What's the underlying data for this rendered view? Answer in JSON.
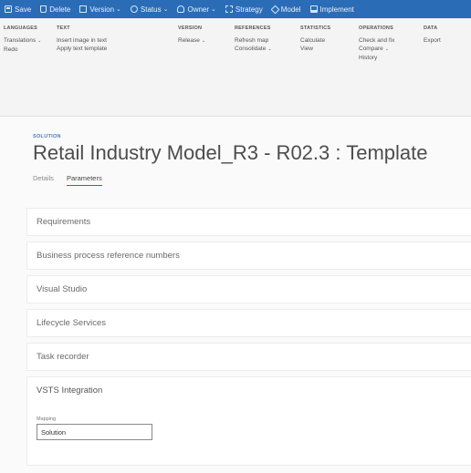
{
  "actionbar": {
    "items": [
      {
        "label": "Save",
        "icon": "save-icon",
        "has_chevron": false
      },
      {
        "label": "Delete",
        "icon": "delete-icon",
        "has_chevron": false
      },
      {
        "label": "Version",
        "icon": "version-icon",
        "has_chevron": true
      },
      {
        "label": "Status",
        "icon": "status-icon",
        "has_chevron": true
      },
      {
        "label": "Owner",
        "icon": "owner-icon",
        "has_chevron": true
      },
      {
        "label": "Strategy",
        "icon": "strategy-icon",
        "has_chevron": false
      },
      {
        "label": "Model",
        "icon": "model-icon",
        "has_chevron": false
      },
      {
        "label": "Implement",
        "icon": "implement-icon",
        "has_chevron": false
      }
    ]
  },
  "ribbon": {
    "groups": [
      {
        "title": "LANGUAGES",
        "items": [
          "Translations",
          "Redo"
        ]
      },
      {
        "title": "TEXT",
        "items": [
          "Insert image in text",
          "Apply text template"
        ]
      },
      {
        "title": "VERSION",
        "items": [
          "Release"
        ]
      },
      {
        "title": "REFERENCES",
        "items": [
          "Refresh map",
          "Consolidate"
        ]
      },
      {
        "title": "STATISTICS",
        "items": [
          "Calculate",
          "View"
        ]
      },
      {
        "title": "OPERATIONS",
        "items": [
          "Check and fix",
          "Compare",
          "History"
        ]
      },
      {
        "title": "DATA",
        "items": [
          "Export"
        ]
      }
    ]
  },
  "page": {
    "eyebrow": "SOLUTION",
    "title": "Retail Industry Model_R3 - R02.3 : Template",
    "tabs": [
      {
        "label": "Details",
        "active": false
      },
      {
        "label": "Parameters",
        "active": true
      }
    ]
  },
  "sections": [
    {
      "label": "Requirements",
      "expanded": false
    },
    {
      "label": "Business process reference numbers",
      "expanded": false
    },
    {
      "label": "Visual Studio",
      "expanded": false
    },
    {
      "label": "Lifecycle Services",
      "expanded": false
    },
    {
      "label": "Task recorder",
      "expanded": false
    },
    {
      "label": "VSTS Integration",
      "expanded": true
    }
  ],
  "vsts": {
    "field_caption": "Mapping",
    "field_value": "Solution"
  },
  "colors": {
    "actionbar": "#2b6cb6",
    "ribbon": "#f4f4f4",
    "accent": "#2b6cb6"
  }
}
